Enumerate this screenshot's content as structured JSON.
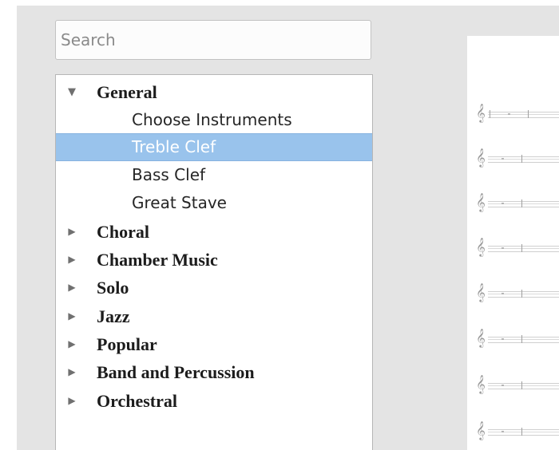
{
  "search": {
    "placeholder": "Search",
    "value": ""
  },
  "tree": {
    "categories": [
      {
        "label": "General",
        "expanded": true,
        "children": [
          {
            "label": "Choose Instruments",
            "selected": false
          },
          {
            "label": "Treble Clef",
            "selected": true
          },
          {
            "label": "Bass Clef",
            "selected": false
          },
          {
            "label": "Great Stave",
            "selected": false
          }
        ]
      },
      {
        "label": "Choral",
        "expanded": false
      },
      {
        "label": "Chamber Music",
        "expanded": false
      },
      {
        "label": "Solo",
        "expanded": false
      },
      {
        "label": "Jazz",
        "expanded": false
      },
      {
        "label": "Popular",
        "expanded": false
      },
      {
        "label": "Band and Percussion",
        "expanded": false
      },
      {
        "label": "Orchestral",
        "expanded": false
      }
    ]
  },
  "icons": {
    "expanded": "triangle-down-icon",
    "collapsed": "triangle-right-icon",
    "clef": "treble-clef-icon"
  },
  "colors": {
    "selection": "#99c3ec",
    "panel_background": "#e4e4e4"
  }
}
